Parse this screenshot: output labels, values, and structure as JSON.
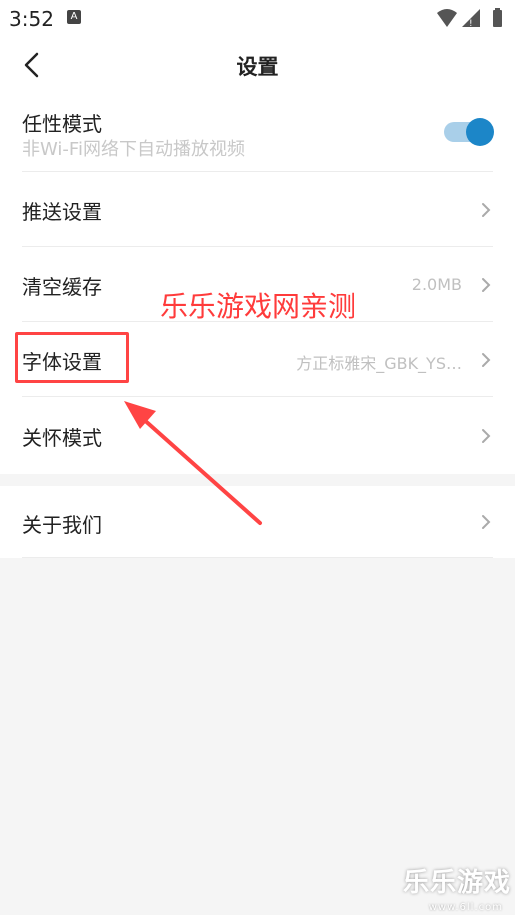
{
  "status_bar": {
    "time": "3:52",
    "notification_icon": "A"
  },
  "header": {
    "title": "设置",
    "back_icon": "chevron-left-icon"
  },
  "settings": {
    "items": [
      {
        "label": "任性模式",
        "sublabel": "非Wi-Fi网络下自动播放视频",
        "toggle_on": true
      },
      {
        "label": "推送设置"
      },
      {
        "label": "清空缓存",
        "value": "2.0MB"
      },
      {
        "label": "字体设置",
        "value": "方正标雅宋_GBK_YS…"
      },
      {
        "label": "关怀模式"
      }
    ],
    "about": {
      "label": "关于我们"
    }
  },
  "overlay": {
    "watermark": "乐乐游戏网亲测",
    "corner_logo": "乐乐游戏",
    "corner_url": "www.6ll.com"
  },
  "colors": {
    "accent": "#1c86c8",
    "annotation": "#ff4444"
  }
}
